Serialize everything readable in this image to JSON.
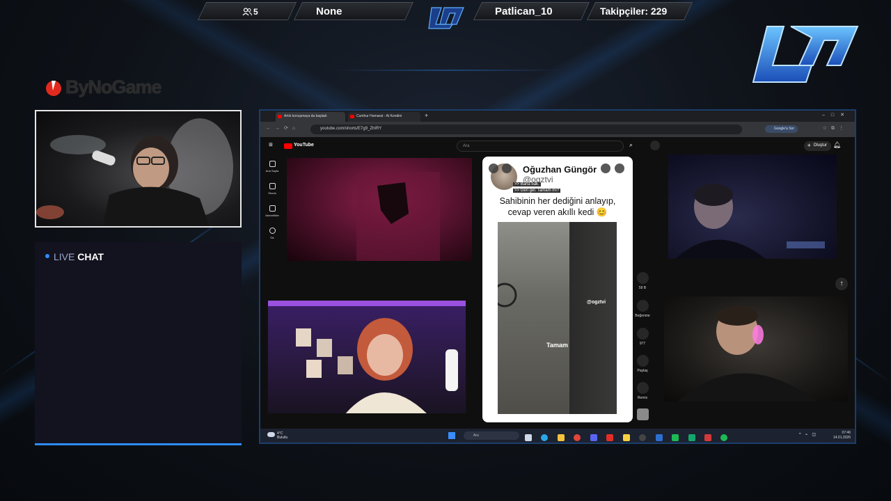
{
  "topbar": {
    "viewers": "5",
    "game": "None",
    "latest_follower": "Patlican_10",
    "followers": "Takipçiler: 229"
  },
  "brand": {
    "sponsor": "ByNoGame"
  },
  "chat": {
    "live": "LIVE",
    "chat": "CHAT"
  },
  "browser": {
    "tabs": [
      "Artık konuşmaya da başladı",
      "Cumhur Hamarat - At Kendini"
    ],
    "url": "youtube.com/shorts/E7g9_ZhIRY",
    "google_sor": "Google'a Sor"
  },
  "youtube": {
    "logo": "YouTube",
    "search_placeholder": "Ara",
    "create": "Oluştur",
    "nav": [
      {
        "label": "Ana Sayfa",
        "icon": "home-icon"
      },
      {
        "label": "Shorts",
        "icon": "shorts-icon"
      },
      {
        "label": "Abonelikler",
        "icon": "subscriptions-icon"
      },
      {
        "label": "Siz",
        "icon": "user-icon"
      }
    ],
    "short": {
      "channel": "Oğuzhan Güngör",
      "handle": "@ogztvi",
      "overlay1": ">> Bana bak.",
      "overlay2": ">> Geri gel. Tamam mı?",
      "caption": "Sahibinin her dediğini anlayıp, cevap veren akıllı kedi 😊",
      "video_tag": "@ogztvi",
      "video_text": "Tamam"
    },
    "actions": [
      {
        "label": "59 B",
        "icon": "like-icon"
      },
      {
        "label": "Beğenme",
        "icon": "dislike-icon"
      },
      {
        "label": "977",
        "icon": "comment-icon"
      },
      {
        "label": "Paylaş",
        "icon": "share-icon"
      },
      {
        "label": "Remix",
        "icon": "remix-icon"
      }
    ]
  },
  "taskbar": {
    "temp": "4°C",
    "weather": "Bulutlu",
    "search": "Ara",
    "time": "07:46",
    "date": "14.01.2026"
  }
}
